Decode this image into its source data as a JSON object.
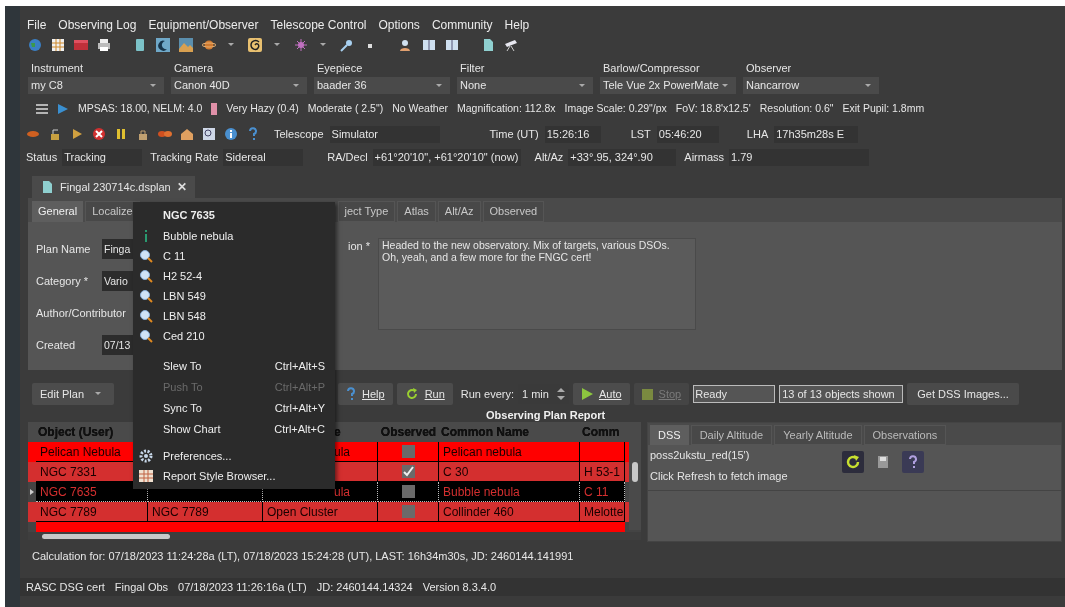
{
  "menu_bar": [
    "File",
    "Observing Log",
    "Equipment/Observer",
    "Telescope Control",
    "Options",
    "Community",
    "Help"
  ],
  "equipment": [
    {
      "label": "Instrument",
      "value": "my C8"
    },
    {
      "label": "Camera",
      "value": "Canon 40D"
    },
    {
      "label": "Eyepiece",
      "value": "baader 36"
    },
    {
      "label": "Filter",
      "value": "None"
    },
    {
      "label": "Barlow/Compressor",
      "value": "Tele Vue 2x PowerMate"
    },
    {
      "label": "Observer",
      "value": "Nancarrow"
    }
  ],
  "conditions": [
    "MPSAS: 18.00, NELM: 4.0",
    "Very Hazy (0.4)",
    "Moderate ( 2.5\")",
    "No Weather",
    "Magnification: 112.8x",
    "Image Scale: 0.29\"/px",
    "FoV: 18.8'x12.5'",
    "Resolution: 0.6\"",
    "Exit Pupil: 1.8mm"
  ],
  "telescope": [
    {
      "label": "Telescope",
      "value": "Simulator"
    },
    {
      "label": "Time (UT)",
      "value": "15:26:16"
    },
    {
      "label": "LST",
      "value": "05:46:20"
    },
    {
      "label": "LHA",
      "value": "17h35m28s E"
    }
  ],
  "status": [
    {
      "label": "Status",
      "value": "Tracking"
    },
    {
      "label": "Tracking Rate",
      "value": "Sidereal"
    },
    {
      "label": "RA/Decl",
      "value": "+61°20'10\", +61°20'10\" (now)"
    },
    {
      "label": "Alt/Az",
      "value": "+33°.95, 324°.90"
    },
    {
      "label": "Airmass",
      "value": "1.79"
    }
  ],
  "document_tab": {
    "title": "Fingal 230714c.dsplan",
    "close": "✕"
  },
  "plan_tabs": [
    {
      "label": "General",
      "selected": true
    },
    {
      "label": "Localize",
      "selected": false
    },
    {
      "label": "ject Type",
      "selected": false
    },
    {
      "label": "Atlas",
      "selected": false
    },
    {
      "label": "Alt/Az",
      "selected": false
    },
    {
      "label": "Observed",
      "selected": false
    }
  ],
  "form": [
    {
      "label": "Plan Name",
      "value": "Finga"
    },
    {
      "label": "Category *",
      "value": "Vario"
    },
    {
      "label": "Author/Contributor"
    },
    {
      "label": "Created",
      "value": "07/13"
    }
  ],
  "description": {
    "label": "ion *",
    "value": "Headed to the new observatory. Mix of targets, various DSOs.\nOh, yeah, and a few more for the FNGC cert!"
  },
  "plan_toolbar": {
    "edit_plan": "Edit Plan",
    "help": "Help",
    "run": "Run",
    "run_every_label": "Run every:",
    "interval": "1 min",
    "auto": "Auto",
    "stop": "Stop",
    "stop_disabled": true,
    "status": "Ready",
    "shown": "13 of 13 objects shown",
    "dss_button": "Get DSS Images..."
  },
  "report": {
    "title": "Observing Plan Report",
    "columns": [
      "Object (User)",
      null,
      "e",
      "Observed",
      "Common Name",
      "Comm"
    ],
    "rows": [
      {
        "cells": [
          "Pelican Nebula",
          null,
          "ula",
          null,
          "Pelican nebula",
          null
        ],
        "observed": false,
        "selected": false,
        "color": "#ff0000"
      },
      {
        "cells": [
          "NGC 7331",
          null,
          null,
          null,
          "C 30",
          "H 53-1"
        ],
        "observed": true,
        "selected": false,
        "color": "#d42f2f"
      },
      {
        "cells": [
          "NGC 7635",
          null,
          "ula",
          null,
          "Bubble nebula",
          "C 11"
        ],
        "observed": false,
        "selected": true
      },
      {
        "cells": [
          "NGC 7789",
          "NGC 7789",
          "Open Cluster",
          null,
          "Collinder 460",
          "Melotte"
        ],
        "observed": false,
        "selected": false,
        "color": "#d42f2f"
      }
    ]
  },
  "dss": {
    "tabs": [
      {
        "label": "DSS",
        "selected": true
      },
      {
        "label": "Daily Altitude",
        "selected": false
      },
      {
        "label": "Yearly Altitude",
        "selected": false
      },
      {
        "label": "Observations",
        "selected": false
      }
    ],
    "survey": "poss2ukstu_red(15')",
    "message": "Click Refresh to fetch image"
  },
  "calculation": "Calculation for: 07/18/2023 11:24:28a (LT), 07/18/2023 15:24:28 (UT), LAST: 16h34m30s, JD: 2460144.141991",
  "status_bar": [
    "RASC DSG cert",
    "Fingal Obs",
    "07/18/2023 11:26:16a (LT)",
    "JD: 2460144.14324",
    "Version 8.3.4.0"
  ],
  "context_menu": [
    {
      "kind": "header",
      "label": "NGC 7635"
    },
    {
      "kind": "info",
      "label": "Bubble nebula"
    },
    {
      "kind": "search",
      "label": "C 11"
    },
    {
      "kind": "search",
      "label": "H2 52-4"
    },
    {
      "kind": "search",
      "label": "LBN 549"
    },
    {
      "kind": "search",
      "label": "LBN 548"
    },
    {
      "kind": "search",
      "label": "Ced 210"
    },
    {
      "kind": "command",
      "label": "Slew To",
      "shortcut": "Ctrl+Alt+S",
      "disabled": false
    },
    {
      "kind": "command",
      "label": "Push To",
      "shortcut": "Ctrl+Alt+P",
      "disabled": true
    },
    {
      "kind": "command",
      "label": "Sync To",
      "shortcut": "Ctrl+Alt+Y",
      "disabled": false
    },
    {
      "kind": "command",
      "label": "Show Chart",
      "shortcut": "Ctrl+Alt+C",
      "disabled": false
    },
    {
      "kind": "preferences",
      "label": "Preferences..."
    },
    {
      "kind": "styles",
      "label": "Report Style Browser..."
    }
  ]
}
